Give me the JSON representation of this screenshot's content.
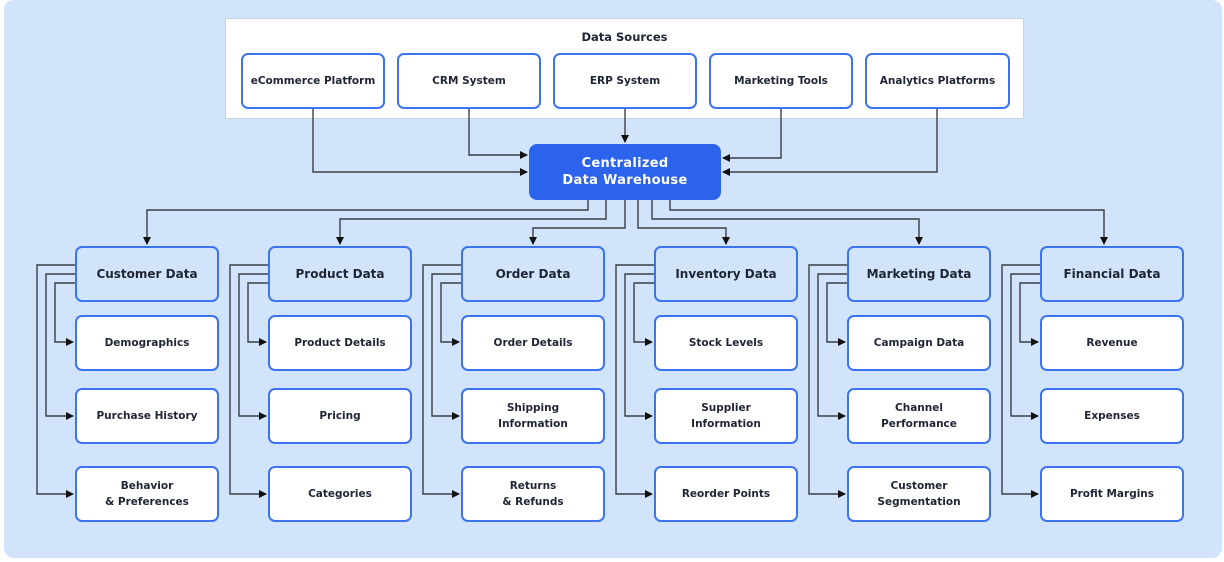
{
  "diagram": {
    "sources_title": "Data Sources",
    "sources": [
      {
        "label": "eCommerce Platform"
      },
      {
        "label": "CRM System"
      },
      {
        "label": "ERP System"
      },
      {
        "label": "Marketing Tools"
      },
      {
        "label": "Analytics Platforms"
      }
    ],
    "warehouse": {
      "label": "Centralized\nData Warehouse"
    },
    "categories": [
      {
        "label": "Customer Data",
        "children": [
          "Demographics",
          "Purchase History",
          "Behavior\n& Preferences"
        ]
      },
      {
        "label": "Product Data",
        "children": [
          "Product Details",
          "Pricing",
          "Categories"
        ]
      },
      {
        "label": "Order Data",
        "children": [
          "Order Details",
          "Shipping\nInformation",
          "Returns\n& Refunds"
        ]
      },
      {
        "label": "Inventory Data",
        "children": [
          "Stock Levels",
          "Supplier\nInformation",
          "Reorder Points"
        ]
      },
      {
        "label": "Marketing Data",
        "children": [
          "Campaign Data",
          "Channel\nPerformance",
          "Customer\nSegmentation"
        ]
      },
      {
        "label": "Financial Data",
        "children": [
          "Revenue",
          "Expenses",
          "Profit Margins"
        ]
      }
    ],
    "colors": {
      "background": "#d1e4fb",
      "node_border": "#3b74ee",
      "warehouse_fill": "#2b63ec",
      "connector": "#3a3f47"
    }
  }
}
